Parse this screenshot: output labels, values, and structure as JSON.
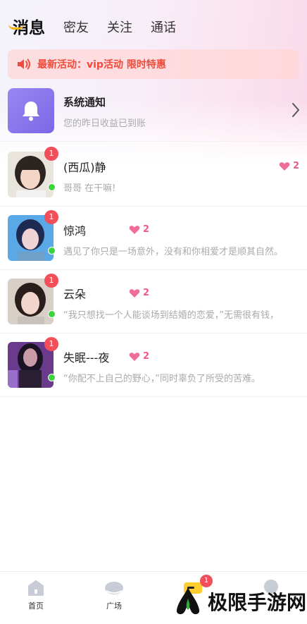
{
  "tabs": [
    {
      "label": "消息",
      "active": true
    },
    {
      "label": "密友",
      "active": false
    },
    {
      "label": "关注",
      "active": false
    },
    {
      "label": "通话",
      "active": false
    }
  ],
  "notice": {
    "text": "最新活动：vip活动 限时特惠",
    "icon": "speaker-icon",
    "color": "#f04a3a"
  },
  "system": {
    "title": "系统通知",
    "subtitle": "您的昨日收益已到账",
    "icon": "bell-icon",
    "accent": "#7a68e6"
  },
  "conversations": [
    {
      "name": "(西瓜)静",
      "unread": "1",
      "hearts": "2",
      "message": "哥哥 在干嘛!",
      "online": true
    },
    {
      "name": "惊鸿",
      "unread": "1",
      "hearts": "2",
      "message": "遇见了你只是一场意外，没有和你相爱才是顺其自然。",
      "online": true
    },
    {
      "name": "云朵",
      "unread": "1",
      "hearts": "2",
      "message": "“我只想找一个人能谈场到结婚的恋爱，”无需很有钱，",
      "online": true
    },
    {
      "name": "失眠---夜",
      "unread": "1",
      "hearts": "2",
      "message": "“你配不上自己的野心，”同时辜负了所受的苦难。",
      "online": true
    }
  ],
  "bottom_nav": [
    {
      "label": "首页",
      "icon": "home-icon"
    },
    {
      "label": "广场",
      "icon": "plaza-icon"
    },
    {
      "label": "",
      "icon": "message-icon",
      "badge": "1"
    },
    {
      "label": "",
      "icon": "profile-icon"
    }
  ],
  "watermark": {
    "text": "极限手游网",
    "icon": "logo-icon"
  }
}
